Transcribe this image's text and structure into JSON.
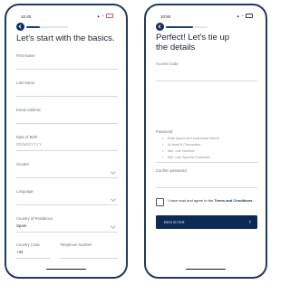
{
  "left_screen": {
    "status_time": "10:40",
    "title": "Let's start with the basics.",
    "progress_fraction": 0.33,
    "fields": {
      "first_name": {
        "label": "First Name"
      },
      "last_name": {
        "label": "Last Name"
      },
      "email": {
        "label": "Email Address"
      },
      "dob": {
        "label": "Date of Birth",
        "placeholder": "DD/MM/YYYY"
      },
      "gender": {
        "label": "Gender"
      },
      "language": {
        "label": "Language"
      },
      "country": {
        "label": "Country of Residence",
        "value": "Spain"
      },
      "country_code": {
        "label": "Country Code",
        "value": "+34"
      },
      "telephone": {
        "label": "Telephone Number"
      }
    }
  },
  "right_screen": {
    "status_time": "10:50",
    "title_line1": "Perfect! Let's tie up",
    "title_line2": "the details",
    "progress_fraction": 0.66,
    "access_code_label": "Access Code",
    "password_label": "Password",
    "password_requirements": [
      "Both upper and lowercase letters",
      "At least 8 Characters",
      "Min. one Number",
      "Min. one Special Character"
    ],
    "confirm_password_label": "Confirm password",
    "terms_text_prefix": "I have read and agree to the ",
    "terms_link": "Terms and Conditions",
    "terms_suffix": ".",
    "register_label": "REGISTER",
    "register_arrow": "›"
  },
  "colors": {
    "accent": "#0d2a55",
    "frame": "#1f3a5c"
  }
}
